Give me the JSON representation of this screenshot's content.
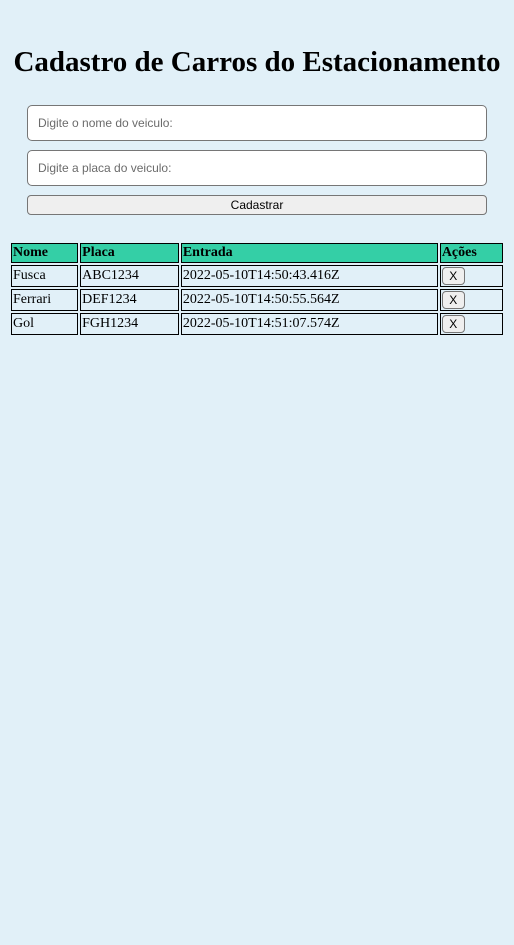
{
  "header": {
    "title": "Cadastro de Carros do Estacionamento"
  },
  "form": {
    "name_placeholder": "Digite o nome do veiculo:",
    "name_value": "",
    "plate_placeholder": "Digite a placa do veiculo:",
    "plate_value": "",
    "submit_label": "Cadastrar"
  },
  "table": {
    "header_color": "#34cfa6",
    "columns": [
      "Nome",
      "Placa",
      "Entrada",
      "Ações"
    ],
    "rows": [
      {
        "nome": "Fusca",
        "placa": "ABC1234",
        "entrada": "2022-05-10T14:50:43.416Z",
        "action_label": "X"
      },
      {
        "nome": "Ferrari",
        "placa": "DEF1234",
        "entrada": "2022-05-10T14:50:55.564Z",
        "action_label": "X"
      },
      {
        "nome": "Gol",
        "placa": "FGH1234",
        "entrada": "2022-05-10T14:51:07.574Z",
        "action_label": "X"
      }
    ]
  },
  "colors": {
    "background": "#e1f0f8",
    "table_header": "#34cfa6"
  }
}
